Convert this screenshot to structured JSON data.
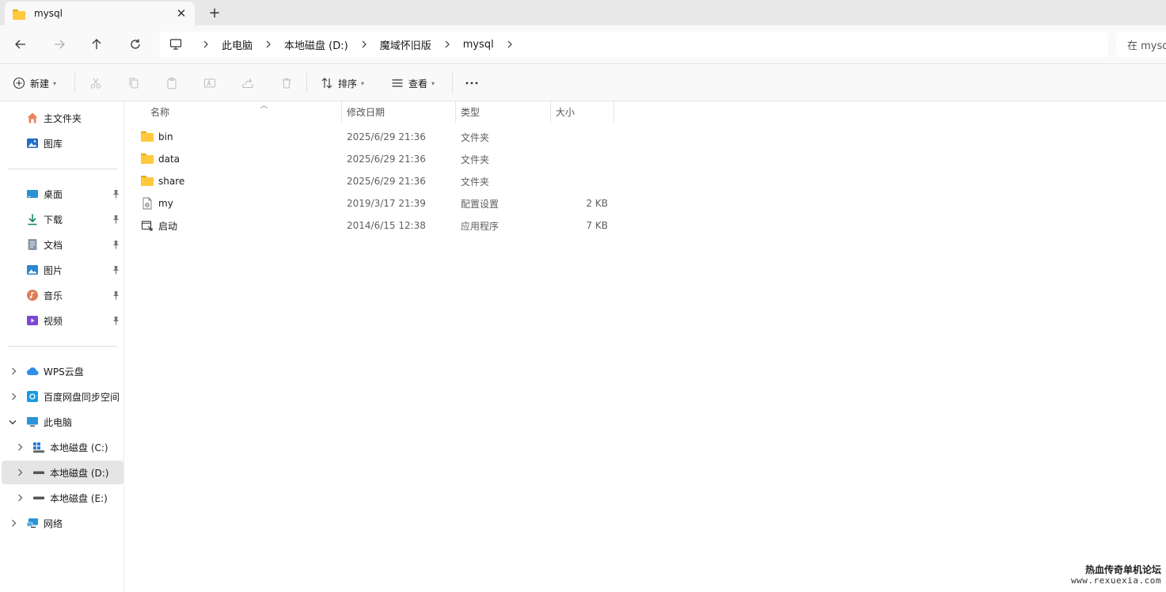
{
  "tab": {
    "title": "mysql",
    "icon": "folder-icon"
  },
  "address": {
    "crumbs": [
      "此电脑",
      "本地磁盘 (D:)",
      "魔域怀旧版",
      "mysql"
    ],
    "search_placeholder": "在 mysql"
  },
  "toolbar": {
    "new_label": "新建",
    "sort_label": "排序",
    "view_label": "查看"
  },
  "sidebar": {
    "home": "主文件夹",
    "gallery": "图库",
    "desktop": "桌面",
    "downloads": "下载",
    "documents": "文档",
    "pictures": "图片",
    "music": "音乐",
    "videos": "视频",
    "wps": "WPS云盘",
    "baidu": "百度网盘同步空间",
    "thispc": "此电脑",
    "drive_c": "本地磁盘 (C:)",
    "drive_d": "本地磁盘 (D:)",
    "drive_e": "本地磁盘 (E:)",
    "network": "网络"
  },
  "columns": {
    "name": "名称",
    "modified": "修改日期",
    "type": "类型",
    "size": "大小"
  },
  "files": [
    {
      "name": "bin",
      "modified": "2025/6/29 21:36",
      "type": "文件夹",
      "size": ""
    },
    {
      "name": "data",
      "modified": "2025/6/29 21:36",
      "type": "文件夹",
      "size": ""
    },
    {
      "name": "share",
      "modified": "2025/6/29 21:36",
      "type": "文件夹",
      "size": ""
    },
    {
      "name": "my",
      "modified": "2019/3/17 21:39",
      "type": "配置设置",
      "size": "2 KB"
    },
    {
      "name": "启动",
      "modified": "2014/6/15 12:38",
      "type": "应用程序",
      "size": "7 KB"
    }
  ],
  "watermark": {
    "title": "热血传奇单机论坛",
    "url": "www.rexuexia.com"
  },
  "colors": {
    "folder": "#ffc83d",
    "selection": "#e5e5e5",
    "accent": "#0067c0"
  }
}
